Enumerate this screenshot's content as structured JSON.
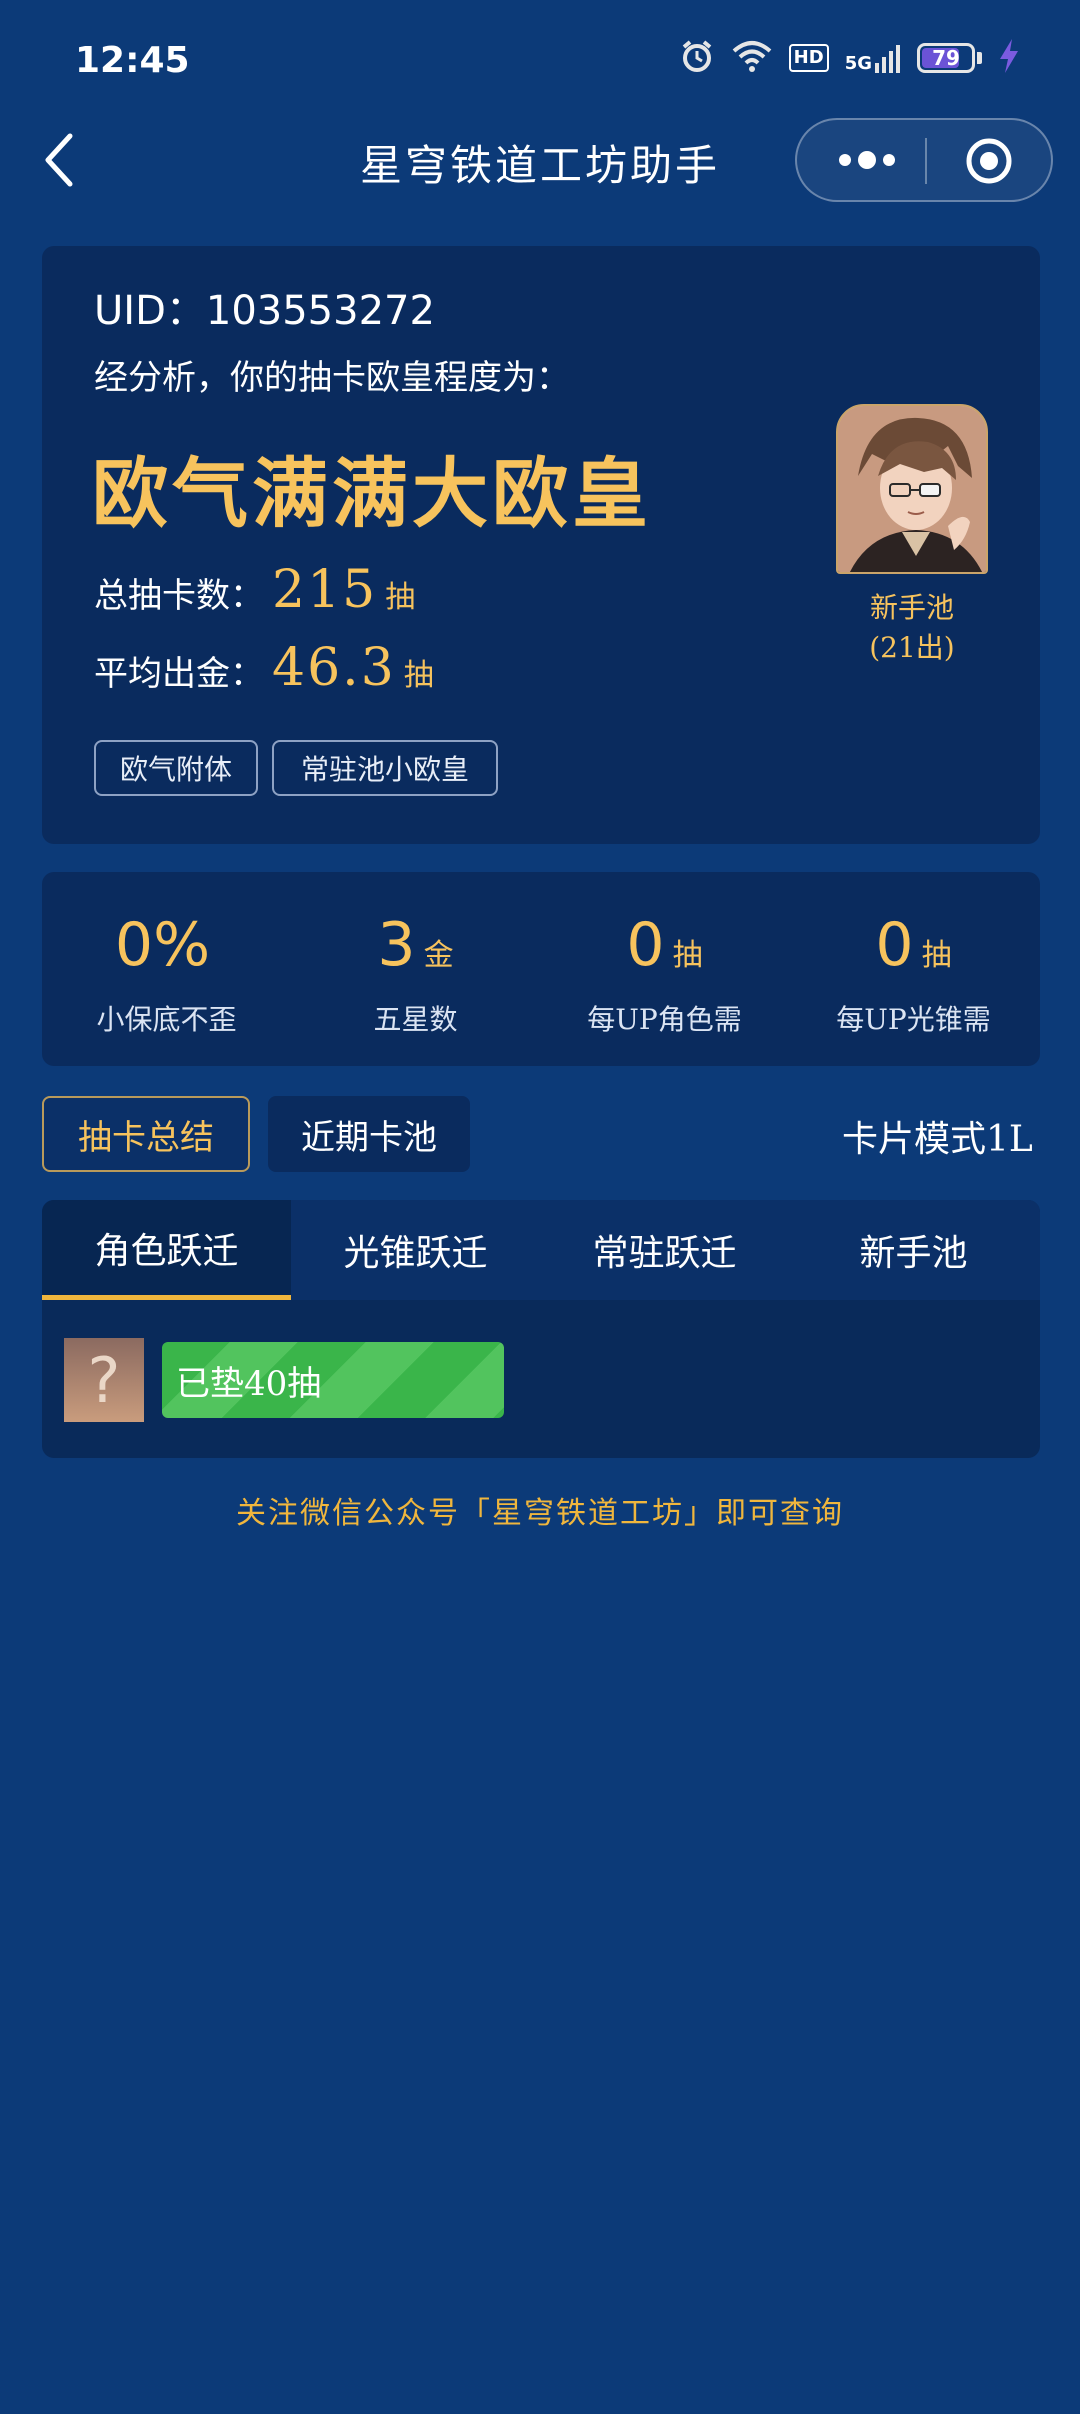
{
  "status_bar": {
    "time": "12:45",
    "network": "5G",
    "hd": "HD",
    "battery": "79",
    "battery_level": 0.79
  },
  "nav": {
    "title": "星穹铁道工坊助手"
  },
  "summary": {
    "uid_label": "UID：",
    "uid": "103553272",
    "analysis": "经分析，你的抽卡欧皇程度为：",
    "luck_title": "欧气满满大欧皇",
    "total_label": "总抽卡数：",
    "total_value": "215",
    "total_unit": "抽",
    "avg_label": "平均出金：",
    "avg_value": "46.3",
    "avg_unit": "抽",
    "tags": [
      "欧气附体",
      "常驻池小欧皇"
    ],
    "featured": {
      "pool": "新手池",
      "count": "(21出)"
    }
  },
  "stats": [
    {
      "value": "0%",
      "unit": "",
      "label": "小保底不歪"
    },
    {
      "value": "3",
      "unit": "金",
      "label": "五星数"
    },
    {
      "value": "0",
      "unit": "抽",
      "label": "每UP角色需"
    },
    {
      "value": "0",
      "unit": "抽",
      "label": "每UP光锥需"
    }
  ],
  "mode_tabs": {
    "summary": "抽卡总结",
    "recent": "近期卡池",
    "card_mode": "卡片模式1L"
  },
  "pool_tabs": [
    "角色跃迁",
    "光锥跃迁",
    "常驻跃迁",
    "新手池"
  ],
  "pity": {
    "icon_text": "?",
    "text": "已垫40抽"
  },
  "footer": "关注微信公众号「星穹铁道工坊」即可查询",
  "colors": {
    "background": "#0c3a78",
    "card": "#0a2b5e",
    "gold": "#f7c35d",
    "accent_tab": "#f0b63d",
    "progress": "#3ab54a"
  }
}
